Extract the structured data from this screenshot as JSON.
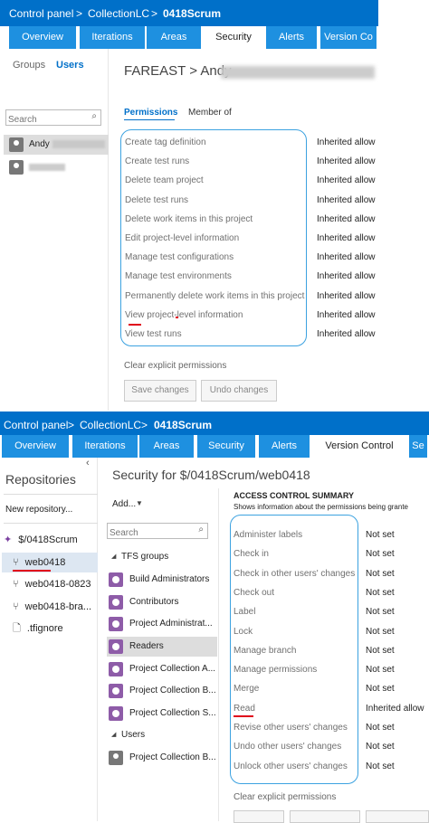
{
  "top": {
    "breadcrumb": [
      "Control panel",
      "CollectionLC",
      "0418Scrum"
    ],
    "separator": ">",
    "tabs": [
      "Overview",
      "Iterations",
      "Areas",
      "Security",
      "Alerts",
      "Version Co"
    ],
    "active_tab": "Security",
    "left_tabs": [
      "Groups",
      "Users"
    ],
    "search_placeholder": "Search",
    "users": [
      "Andy"
    ],
    "title": "FAREAST > Andy",
    "subtabs": [
      "Permissions",
      "Member of"
    ],
    "permissions": [
      {
        "name": "Create tag definition",
        "value": "Inherited allow"
      },
      {
        "name": "Create test runs",
        "value": "Inherited allow"
      },
      {
        "name": "Delete team project",
        "value": "Inherited allow"
      },
      {
        "name": "Delete test runs",
        "value": "Inherited allow"
      },
      {
        "name": "Delete work items in this project",
        "value": "Inherited allow"
      },
      {
        "name": "Edit project-level information",
        "value": "Inherited allow"
      },
      {
        "name": "Manage test configurations",
        "value": "Inherited allow"
      },
      {
        "name": "Manage test environments",
        "value": "Inherited allow"
      },
      {
        "name": "Permanently delete work items in this project",
        "value": "Inherited allow"
      },
      {
        "name": "View project-level information",
        "value": "Inherited allow"
      },
      {
        "name": "View test runs",
        "value": "Inherited allow"
      }
    ],
    "clear_link": "Clear explicit permissions",
    "save_button": "Save changes",
    "undo_button": "Undo changes"
  },
  "bottom": {
    "breadcrumb": [
      "Control panel",
      "CollectionLC",
      "0418Scrum"
    ],
    "separator": ">",
    "tabs": [
      "Overview",
      "Iterations",
      "Areas",
      "Security",
      "Alerts",
      "Version Control",
      "Se"
    ],
    "active_tab": "Version Control",
    "repositories_title": "Repositories",
    "new_repo": "New repository...",
    "repos": [
      "$/0418Scrum",
      "web0418",
      "web0418-0823",
      "web0418-bra...",
      ".tfignore"
    ],
    "title": "Security for $/0418Scrum/web0418",
    "add_button": "Add...",
    "search_placeholder": "Search",
    "tfs_groups_label": "TFS groups",
    "groups": [
      "Build Administrators",
      "Contributors",
      "Project Administrat...",
      "Readers",
      "Project Collection A...",
      "Project Collection B...",
      "Project Collection S..."
    ],
    "users_label": "Users",
    "users": [
      "Project Collection B..."
    ],
    "acs_title": "ACCESS CONTROL SUMMARY",
    "acs_subtitle": "Shows information about the permissions being grante",
    "permissions": [
      {
        "name": "Administer labels",
        "value": "Not set"
      },
      {
        "name": "Check in",
        "value": "Not set"
      },
      {
        "name": "Check in other users' changes",
        "value": "Not set"
      },
      {
        "name": "Check out",
        "value": "Not set"
      },
      {
        "name": "Label",
        "value": "Not set"
      },
      {
        "name": "Lock",
        "value": "Not set"
      },
      {
        "name": "Manage branch",
        "value": "Not set"
      },
      {
        "name": "Manage permissions",
        "value": "Not set"
      },
      {
        "name": "Merge",
        "value": "Not set"
      },
      {
        "name": "Read",
        "value": "Inherited allow"
      },
      {
        "name": "Revise other users' changes",
        "value": "Not set"
      },
      {
        "name": "Undo other users' changes",
        "value": "Not set"
      },
      {
        "name": "Unlock other users' changes",
        "value": "Not set"
      }
    ],
    "clear_link": "Clear explicit permissions"
  },
  "colors": {
    "header": "#0070c9",
    "tab": "#1e90e0",
    "accent": "#0070c9",
    "annotation": "#e0001a",
    "outline": "#3ca2e0"
  },
  "icons": [
    "search-icon",
    "user-icon",
    "group-icon",
    "folder-icon",
    "branch-icon",
    "file-icon",
    "chevron-left-icon",
    "caret-down-icon"
  ]
}
